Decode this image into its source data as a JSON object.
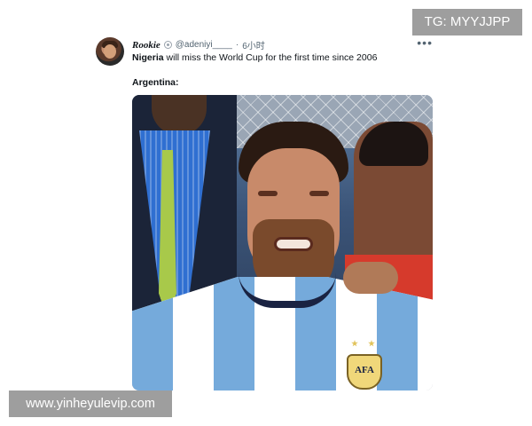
{
  "tweet": {
    "display_name": "Rookie",
    "handle": "@adeniyi____",
    "separator": "·",
    "time": "6小时",
    "more_icon": "more-horizontal-icon",
    "text_line1_bold": "Nigeria",
    "text_line1_rest": " will miss the World Cup for the first time since 2006",
    "text_line2": "Argentina:",
    "photo_crest_text": "AFA"
  },
  "overlays": {
    "top_watermark": "TG: MYYJJPP",
    "bottom_watermark": "www.yinheyulevip.com"
  },
  "colors": {
    "watermark_bg": "#9e9e9e",
    "text_primary": "#0f1419",
    "text_secondary": "#536471"
  }
}
